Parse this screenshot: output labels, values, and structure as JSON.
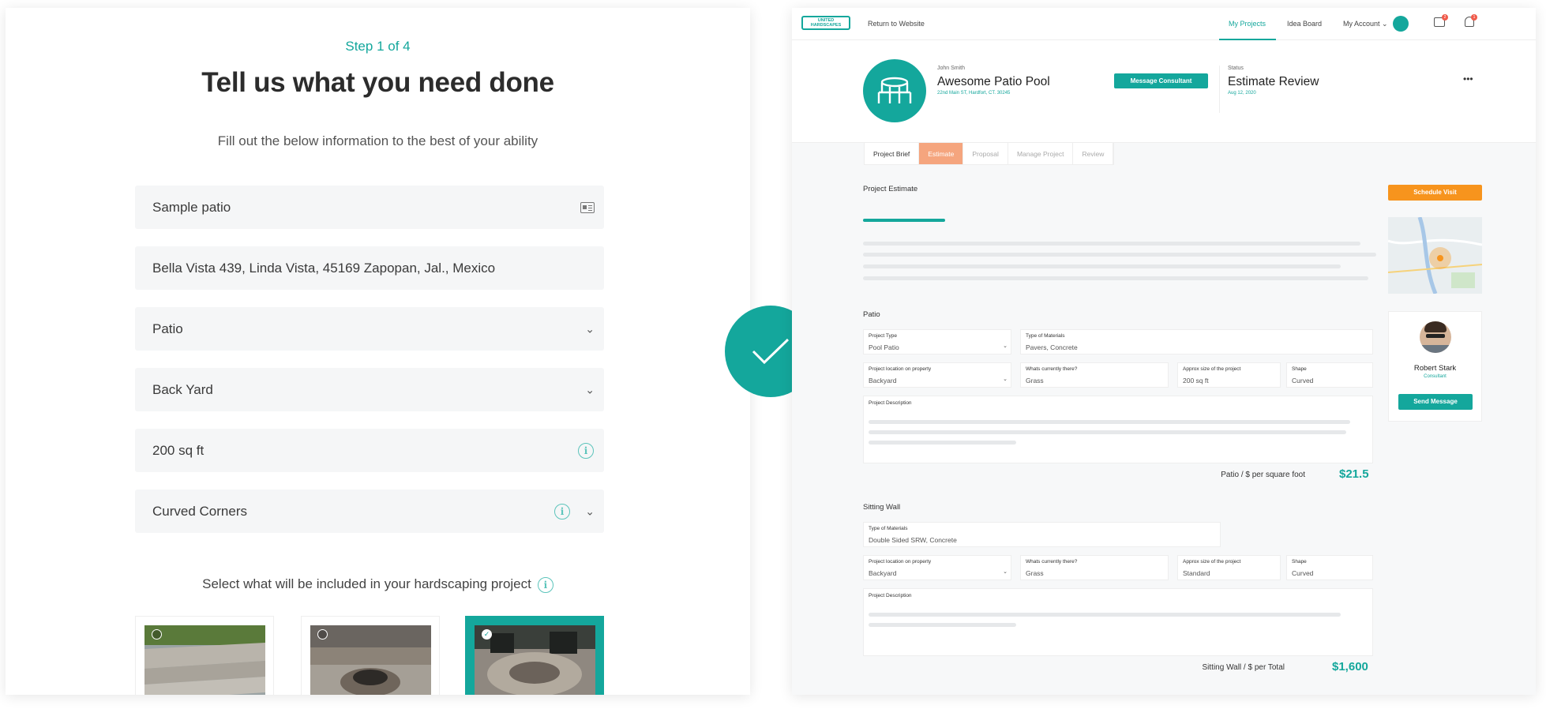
{
  "left": {
    "step": "Step 1 of 4",
    "title": "Tell us what you need done",
    "subtitle": "Fill out the below information to the best of your ability",
    "fields": {
      "name": "Sample patio",
      "address": "Bella Vista 439, Linda Vista, 45169 Zapopan, Jal., Mexico",
      "project_type": "Patio",
      "location": "Back Yard",
      "size": "200 sq ft",
      "shape": "Curved Corners"
    },
    "include_label": "Select what will be included in your hardscaping project",
    "options": [
      {
        "name": "steps",
        "selected": false
      },
      {
        "name": "fire-pit",
        "selected": false
      },
      {
        "name": "sitting-wall-fire-pit",
        "selected": true
      }
    ]
  },
  "right": {
    "nav": {
      "logo_line1": "UNITED",
      "logo_line2": "HARDSCAPES",
      "return": "Return to Website",
      "my_projects": "My Projects",
      "idea_board": "Idea Board",
      "my_account": "My Account",
      "inbox_badge": "2",
      "bell_badge": "1"
    },
    "header": {
      "client": "John Smith",
      "project_name": "Awesome Patio Pool",
      "address": "22nd Main ST, Hardfort, CT. 30245",
      "message_btn": "Message Consultant",
      "status_label": "Status",
      "status_value": "Estimate Review",
      "status_date": "Aug 12, 2020",
      "more": "•••"
    },
    "tabs": [
      "Project Brief",
      "Estimate",
      "Proposal",
      "Manage Project",
      "Review"
    ],
    "estimate_title": "Project Estimate",
    "schedule_btn": "Schedule Visit",
    "consultant": {
      "name": "Robert Stark",
      "role": "Consultant",
      "send_btn": "Send Message"
    },
    "patio": {
      "title": "Patio",
      "project_type_label": "Project Type",
      "project_type": "Pool Patio",
      "materials_label": "Type of Materials",
      "materials": "Pavers, Concrete",
      "location_label": "Project location on property",
      "location": "Backyard",
      "current_label": "Whats currently there?",
      "current": "Grass",
      "size_label": "Approx size of the project",
      "size": "200 sq ft",
      "shape_label": "Shape",
      "shape": "Curved",
      "desc_label": "Project Description",
      "price_label": "Patio / $ per square foot",
      "price": "$21.5"
    },
    "sitting_wall": {
      "title": "Sitting Wall",
      "materials_label": "Type of Materials",
      "materials": "Double Sided SRW, Concrete",
      "location_label": "Project location on property",
      "location": "Backyard",
      "current_label": "Whats currently there?",
      "current": "Grass",
      "size_label": "Approx size of the project",
      "size": "Standard",
      "shape_label": "Shape",
      "shape": "Curved",
      "desc_label": "Project Description",
      "price_label": "Sitting Wall / $ per Total",
      "price": "$1,600"
    },
    "colors": {
      "teal": "#14a79c",
      "orange": "#f7941d",
      "estimate_tab": "#f5a57e"
    }
  }
}
